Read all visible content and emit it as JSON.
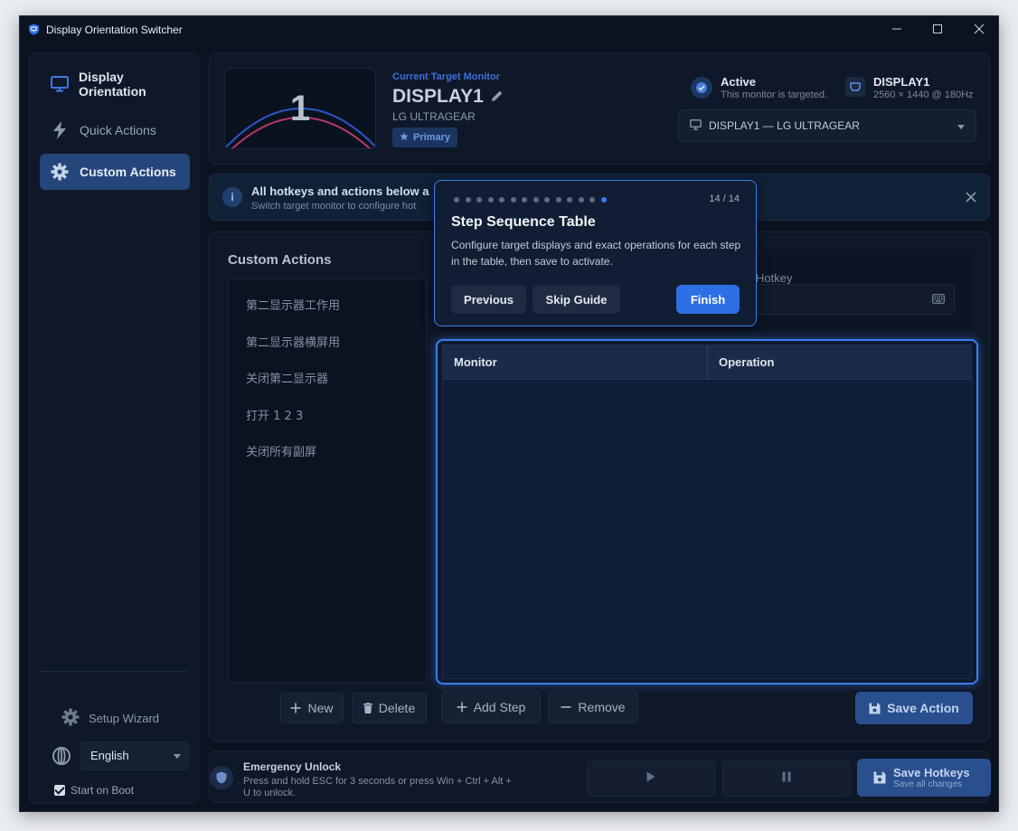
{
  "window": {
    "title": "Display Orientation Switcher"
  },
  "sidebar": {
    "items": [
      {
        "label": "Display Orientation"
      },
      {
        "label": "Quick Actions"
      },
      {
        "label": "Custom Actions"
      }
    ],
    "setup_wizard": "Setup Wizard",
    "language": "English",
    "start_on_boot": "Start on Boot"
  },
  "monitor": {
    "thumb_number": "1",
    "current_label": "Current Target Monitor",
    "name": "DISPLAY1",
    "model": "LG ULTRAGEAR",
    "primary_badge": "Primary",
    "status_title": "Active",
    "status_sub": "This monitor is targeted.",
    "res_name": "DISPLAY1",
    "res_detail": "2560 × 1440 @ 180Hz",
    "selector_value": "DISPLAY1 — LG ULTRAGEAR"
  },
  "banner": {
    "title": "All hotkeys and actions below a",
    "subtitle": "Switch target monitor to configure hot"
  },
  "custom_actions": {
    "title": "Custom Actions",
    "items": [
      "第二显示器工作用",
      "第二显示器横屏用",
      "关闭第二显示器",
      "打开 1 2 3",
      "关闭所有副屏"
    ],
    "new_label": "New",
    "delete_label": "Delete",
    "hotkey_label": "Hotkey",
    "add_step_label": "Add Step",
    "remove_label": "Remove",
    "save_action_label": "Save Action",
    "table": {
      "headers": [
        "Monitor",
        "Operation"
      ],
      "rows": []
    }
  },
  "footer": {
    "title": "Emergency Unlock",
    "subtitle": "Press and hold ESC for 3 seconds or press Win + Ctrl + Alt + U to unlock.",
    "save_title": "Save Hotkeys",
    "save_sub": "Save all changes"
  },
  "guide": {
    "step_count": "14 / 14",
    "current_step": 14,
    "total_steps": 14,
    "title": "Step Sequence Table",
    "description": "Configure target displays and exact operations for each step in the table, then save to activate.",
    "previous_label": "Previous",
    "skip_label": "Skip Guide",
    "finish_label": "Finish"
  },
  "colors": {
    "accent": "#3a7ff0",
    "background": "#0c1320",
    "active_nav": "#25467a"
  }
}
